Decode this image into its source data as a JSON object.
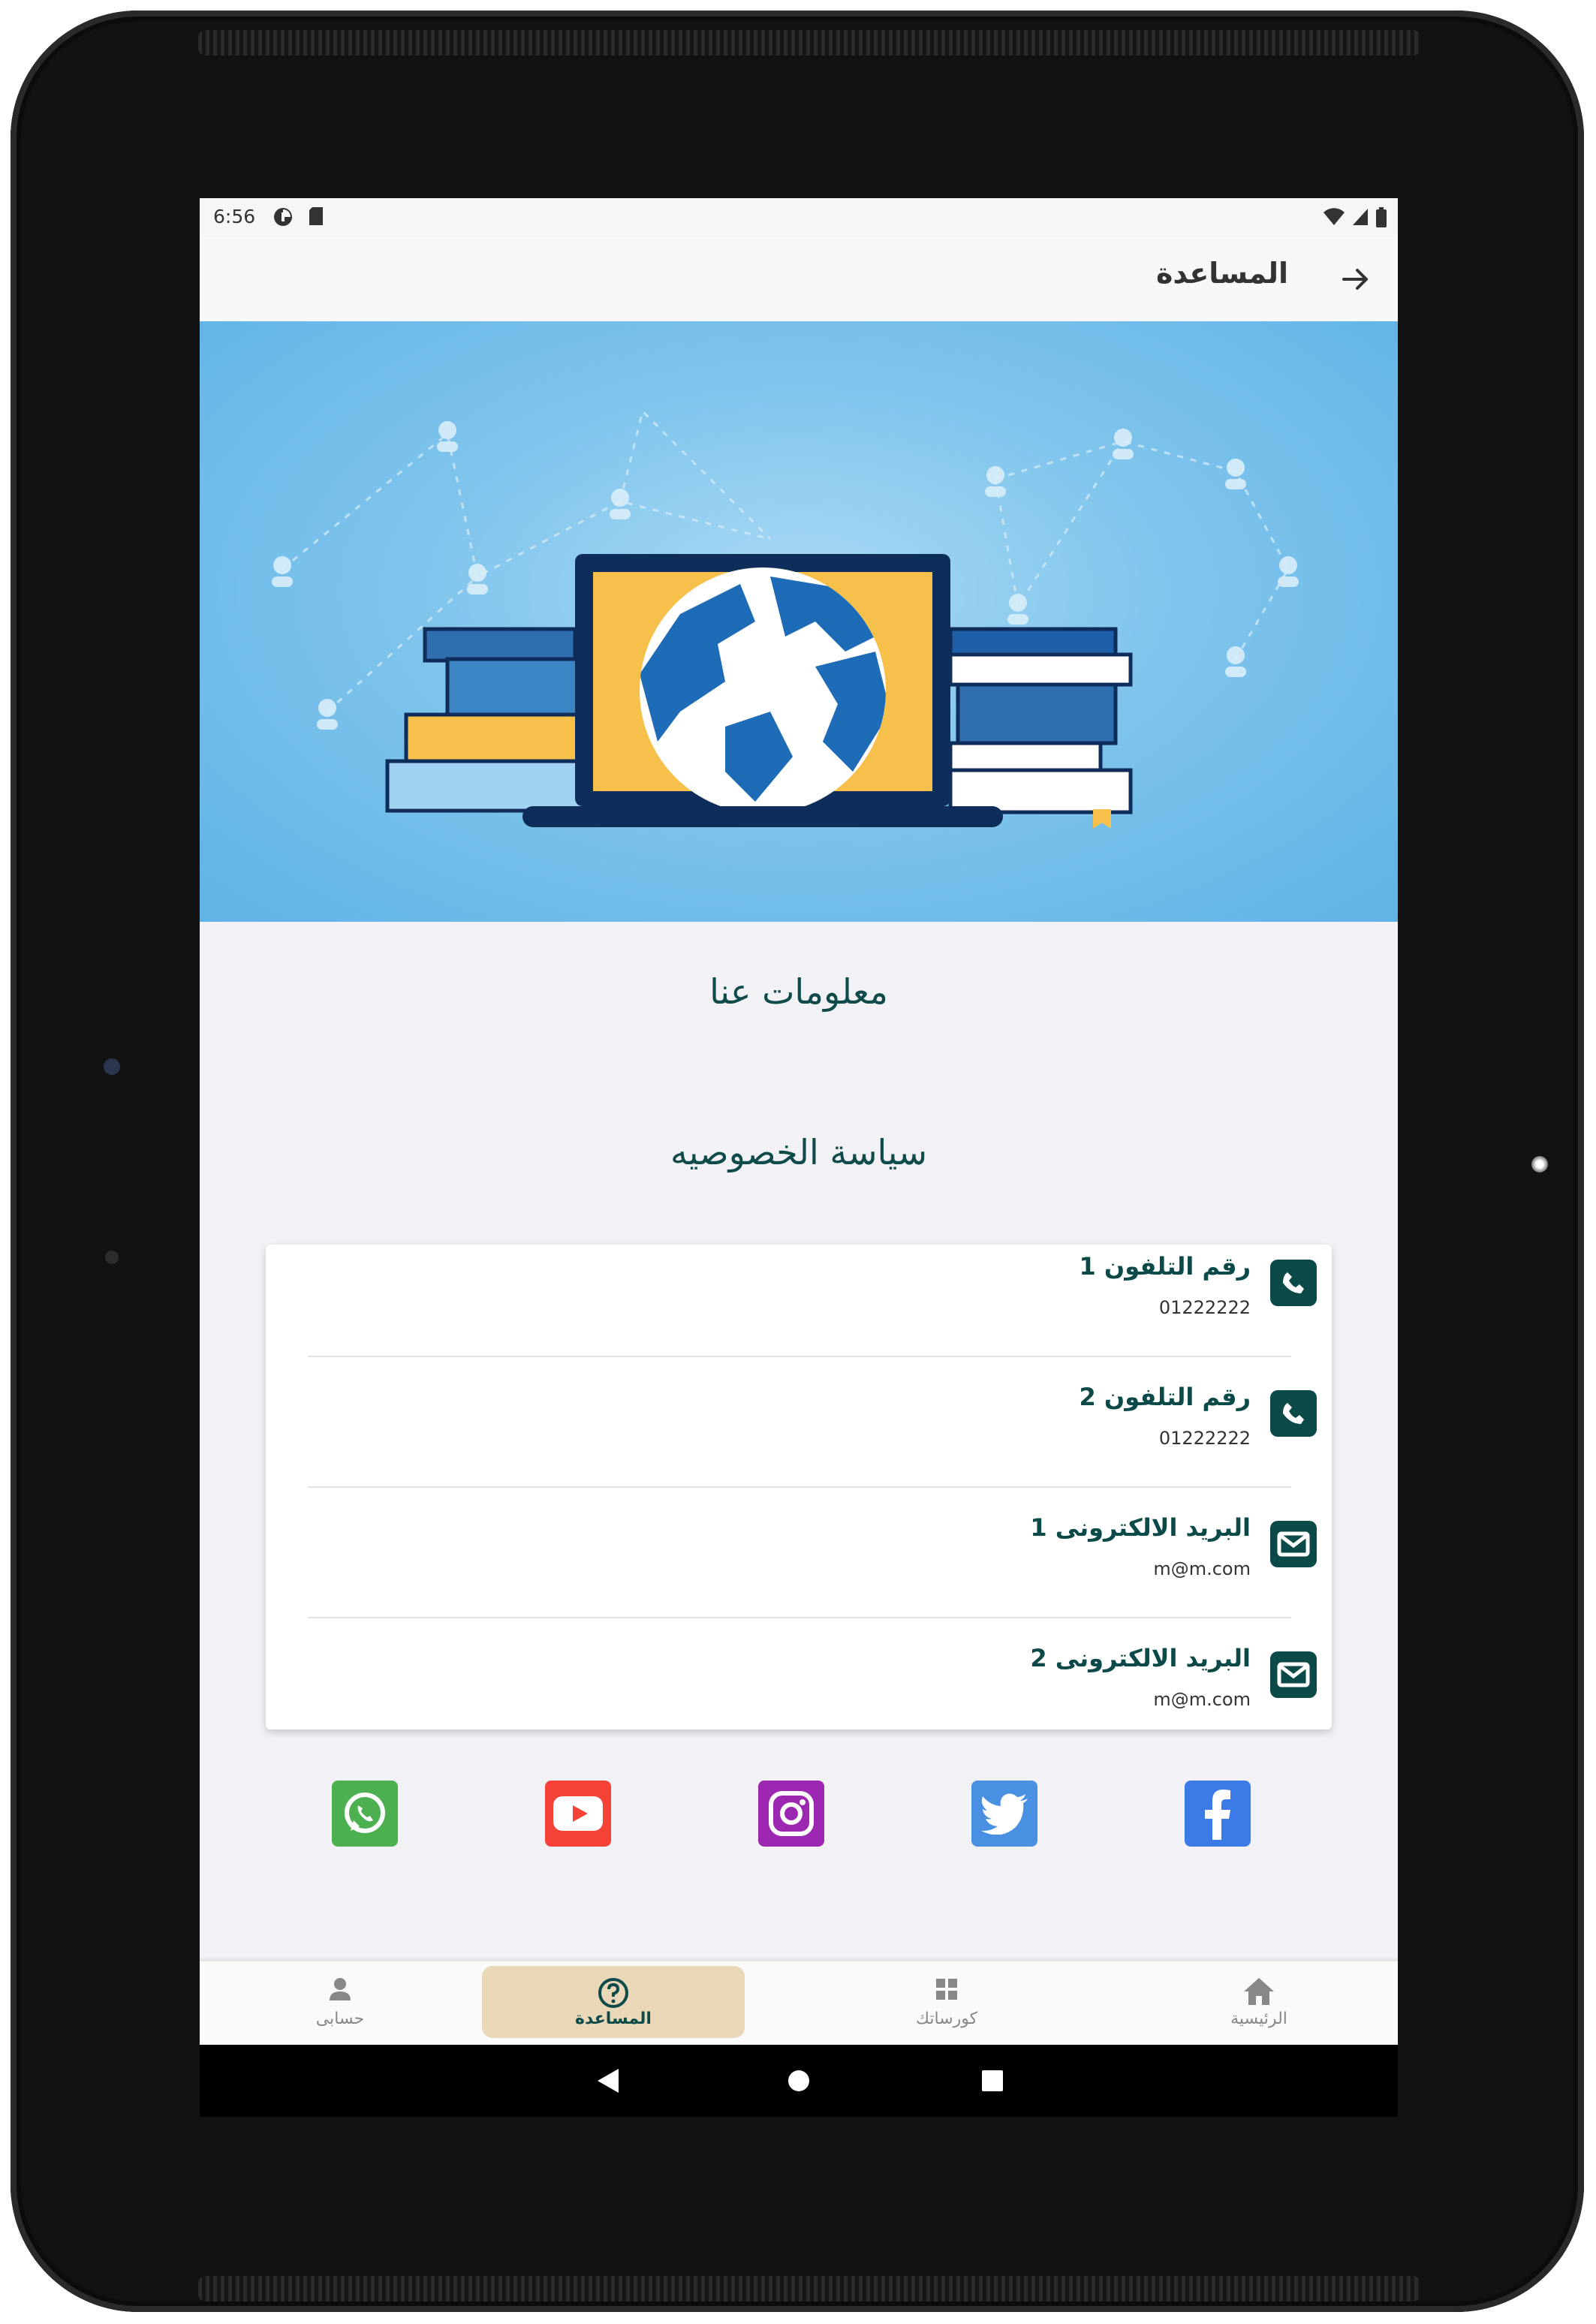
{
  "status_bar": {
    "time": "6:56",
    "left_icons": [
      "data-saver-icon",
      "sd-card-icon"
    ],
    "right_icons": [
      "wifi-icon",
      "signal-icon",
      "battery-icon"
    ]
  },
  "app_bar": {
    "title": "المساعدة",
    "back_icon": "arrow-right-icon"
  },
  "hero": {
    "image": "laptop-globe-books-illustration"
  },
  "links": {
    "about": "معلومات عنا",
    "privacy": "سياسة الخصوصيه"
  },
  "contacts": [
    {
      "icon": "phone-icon",
      "title": "رقم التلفون 1",
      "value": "01222222"
    },
    {
      "icon": "phone-icon",
      "title": "رقم التلفون 2",
      "value": "01222222"
    },
    {
      "icon": "mail-icon",
      "title": "البريد الالكترونى 1",
      "value": "m@m.com"
    },
    {
      "icon": "mail-icon",
      "title": "البريد الالكترونى 2",
      "value": "m@m.com"
    }
  ],
  "social": [
    {
      "name": "whatsapp",
      "color": "#4caf50"
    },
    {
      "name": "youtube",
      "color": "#f44336"
    },
    {
      "name": "instagram",
      "color": "#9c27b0"
    },
    {
      "name": "twitter",
      "color": "#4a90e2"
    },
    {
      "name": "facebook",
      "color": "#3b7be8"
    }
  ],
  "bottom_nav": {
    "items": [
      {
        "label": "حسابى",
        "icon": "person-icon",
        "active": false
      },
      {
        "label": "المساعدة",
        "icon": "help-icon",
        "active": true
      },
      {
        "label": "كورساتك",
        "icon": "grid-icon",
        "active": false
      },
      {
        "label": "الرئيسية",
        "icon": "home-icon",
        "active": false
      }
    ]
  },
  "colors": {
    "primary": "#0b4a48",
    "active_tab_bg": "#ead7b7",
    "hero_blue": "#5fb3e6"
  }
}
